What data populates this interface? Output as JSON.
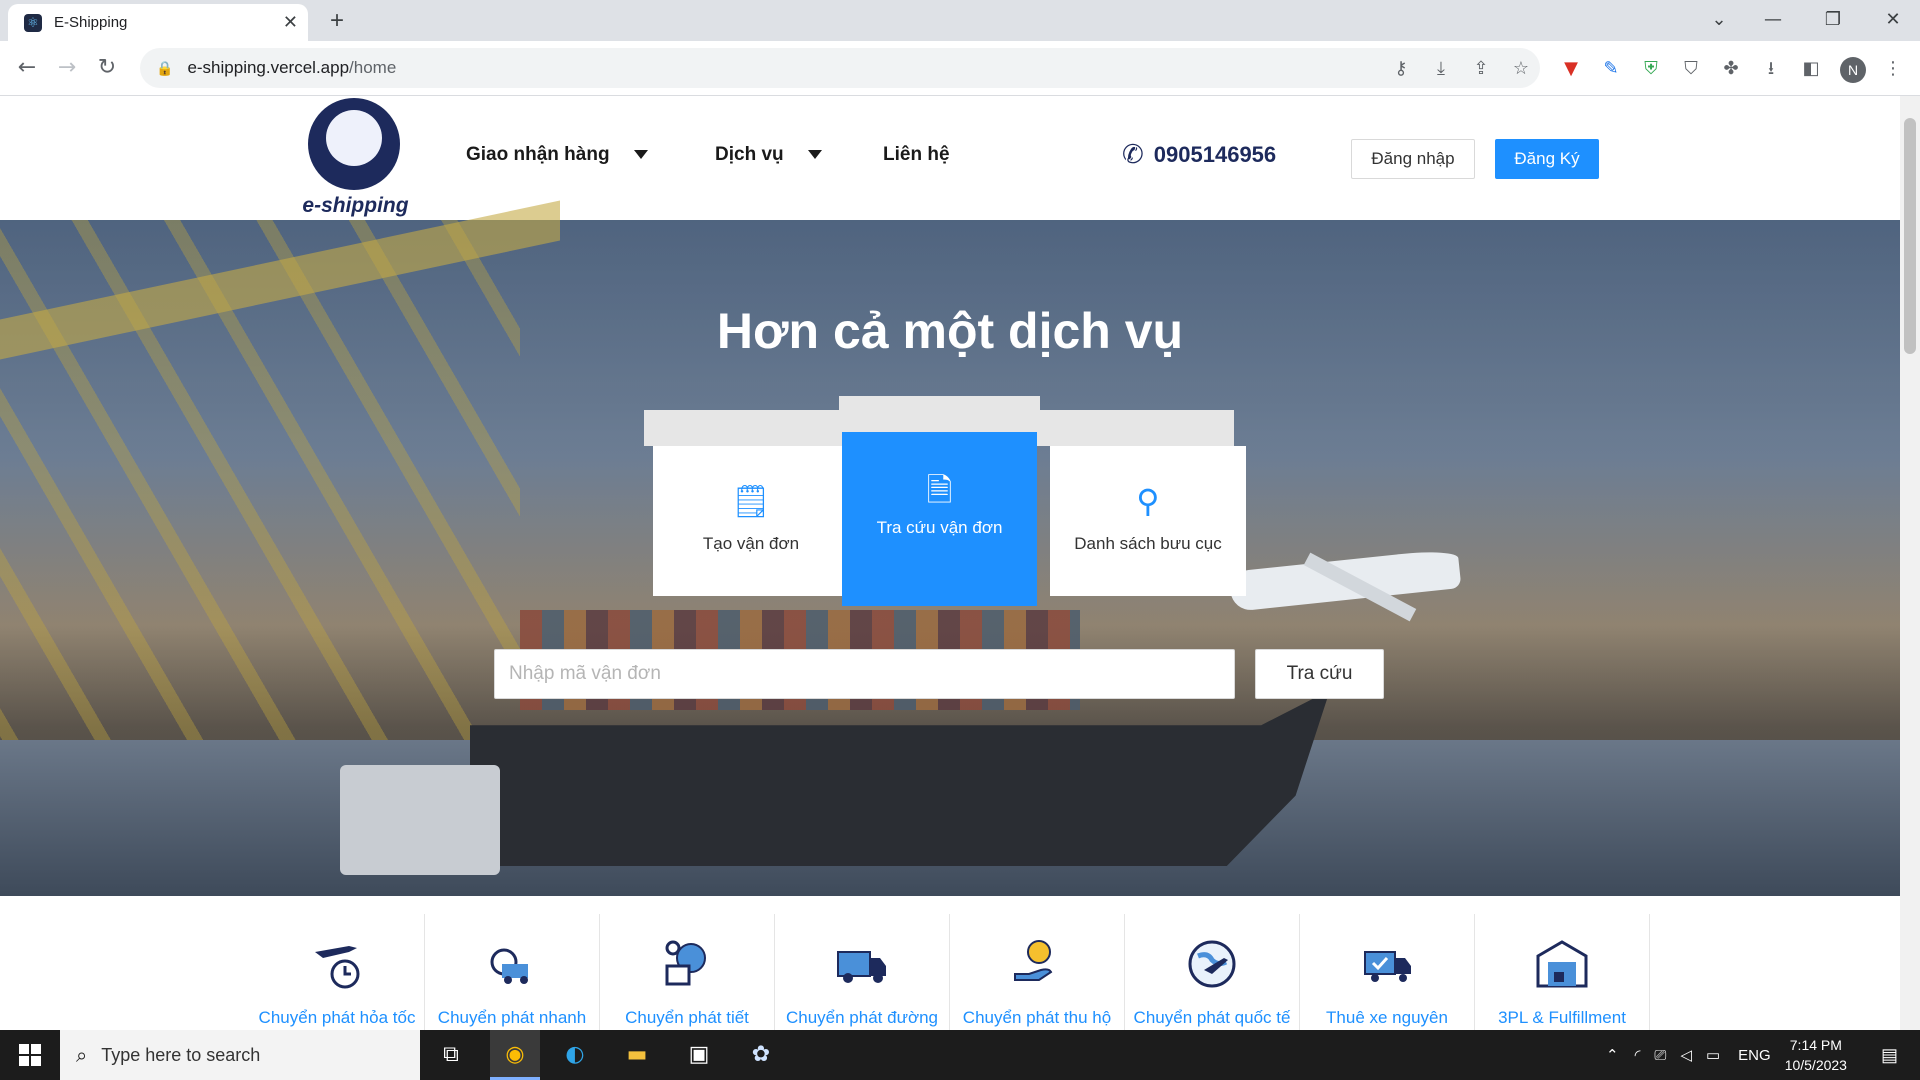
{
  "browser": {
    "tab_title": "E-Shipping",
    "tab_close": "✕",
    "new_tab": "+",
    "url_host": "e-shipping.vercel.app",
    "url_path": "/home",
    "profile_initial": "N"
  },
  "header": {
    "logo_text": "e-shipping",
    "menu": [
      {
        "label": "Giao nhận hàng",
        "has_dropdown": true
      },
      {
        "label": "Dịch vụ",
        "has_dropdown": true
      },
      {
        "label": "Liên hệ",
        "has_dropdown": false
      }
    ],
    "phone": "0905146956",
    "login_label": "Đăng nhập",
    "signup_label": "Đăng Ký",
    "colors": {
      "primary": "#1e90ff",
      "navy": "#1d2a5c"
    }
  },
  "hero": {
    "title": "Hơn cả một dịch vụ",
    "cards": [
      {
        "label": "Tạo vận đơn",
        "icon": "create-order-icon",
        "active": false
      },
      {
        "label": "Tra cứu vận đơn",
        "icon": "search-document-icon",
        "active": true
      },
      {
        "label": "Danh sách bưu cục",
        "icon": "location-pin-icon",
        "active": false
      }
    ],
    "search_placeholder": "Nhập mã vận đơn",
    "search_button": "Tra cứu"
  },
  "services": [
    {
      "label": "Chuyển phát hỏa tốc",
      "icon": "airplane-clock-icon"
    },
    {
      "label": "Chuyển phát nhanh",
      "icon": "fast-truck-icon"
    },
    {
      "label": "Chuyển phát tiết kiệm (MES)",
      "icon": "globe-delivery-icon"
    },
    {
      "label": "Chuyển phát đường bộ",
      "icon": "truck-icon"
    },
    {
      "label": "Chuyển phát thu hộ (COD)",
      "icon": "coin-hand-icon"
    },
    {
      "label": "Chuyển phát quốc tế",
      "icon": "world-plane-icon"
    },
    {
      "label": "Thuê xe nguyên chuyến",
      "icon": "truck-check-icon"
    },
    {
      "label": "3PL & Fulfillment",
      "icon": "warehouse-icon"
    }
  ],
  "taskbar": {
    "search_placeholder": "Type here to search",
    "language": "ENG",
    "time": "7:14 PM",
    "date": "10/5/2023"
  }
}
